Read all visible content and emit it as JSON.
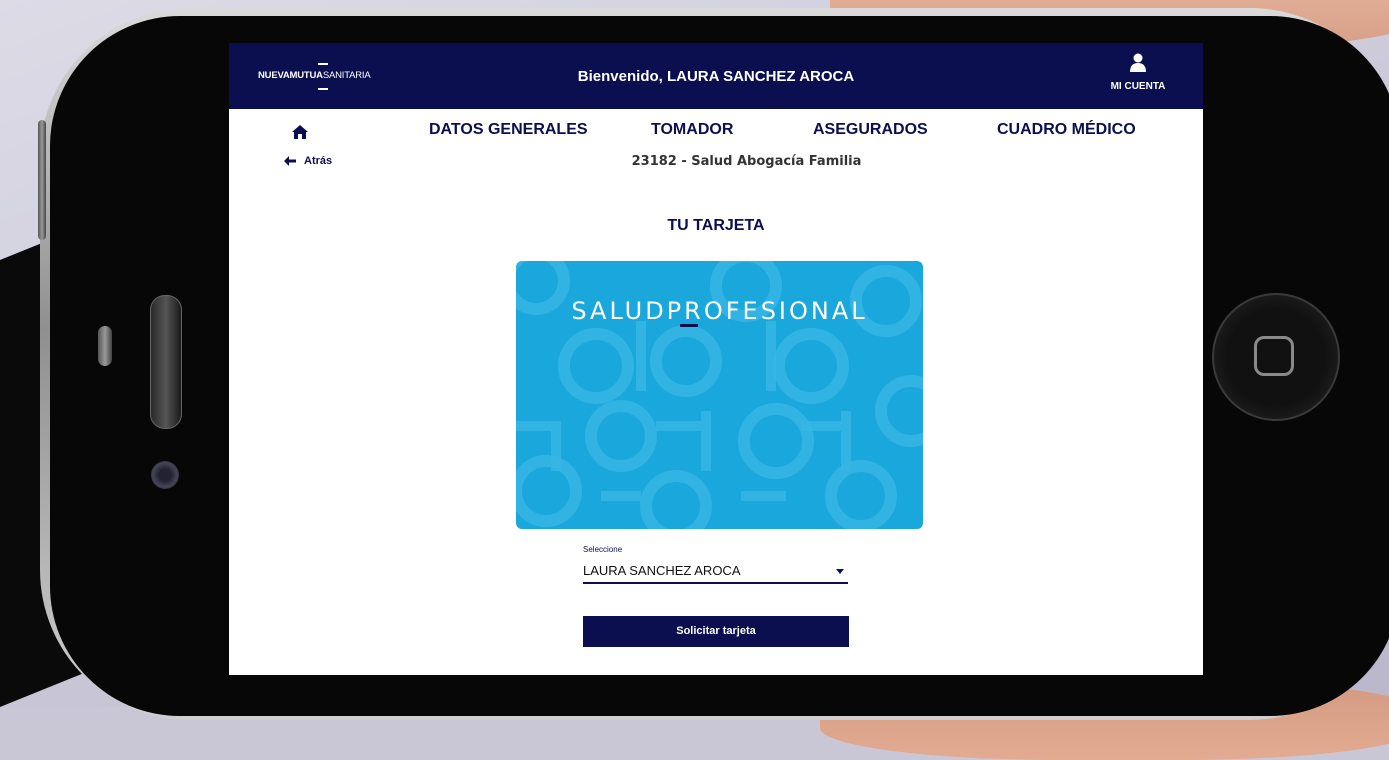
{
  "header": {
    "logo_bold": "NUEVAMUTUA",
    "logo_light": "SANITARIA",
    "welcome": "Bienvenido, LAURA SANCHEZ AROCA",
    "account_label": "MI CUENTA"
  },
  "nav": {
    "items": [
      {
        "label": "DATOS GENERALES"
      },
      {
        "label": "TOMADOR"
      },
      {
        "label": "ASEGURADOS"
      },
      {
        "label": "CUADRO MÉDICO"
      }
    ],
    "back_label": "Atrás"
  },
  "policy": "23182 - Salud Abogacía Familia",
  "card_section": {
    "title": "TU TARJETA",
    "card_brand": "SALUDPROFESIONAL"
  },
  "selector": {
    "label": "Seleccione",
    "value": "LAURA SANCHEZ AROCA"
  },
  "request_button": "Solicitar tarjeta",
  "colors": {
    "brand_navy": "#0b0f4f",
    "card_blue": "#19a7dc"
  }
}
